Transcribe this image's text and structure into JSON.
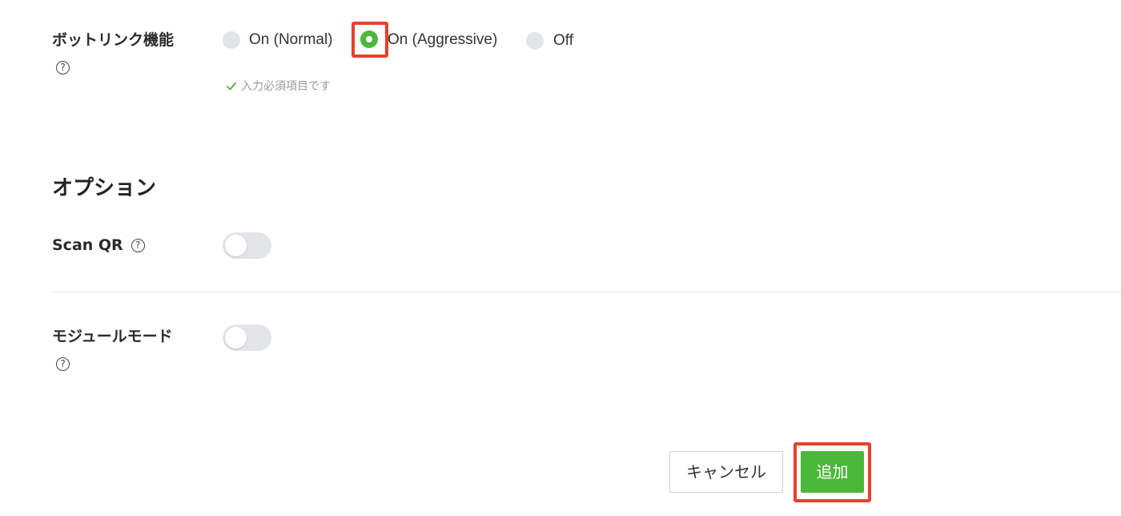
{
  "bot_link": {
    "label": "ボットリンク機能",
    "options": [
      {
        "label": "On (Normal)",
        "selected": false
      },
      {
        "label": "On (Aggressive)",
        "selected": true
      },
      {
        "label": "Off",
        "selected": false
      }
    ],
    "validation": "入力必須項目です"
  },
  "options_section": {
    "title": "オプション",
    "scan_qr": {
      "label": "Scan QR",
      "enabled": false
    },
    "module_mode": {
      "label": "モジュールモード",
      "enabled": false
    }
  },
  "actions": {
    "cancel_label": "キャンセル",
    "add_label": "追加"
  },
  "help_icon_glyph": "?",
  "colors": {
    "accent_green": "#4cb839",
    "highlight_red": "#e8412c"
  }
}
